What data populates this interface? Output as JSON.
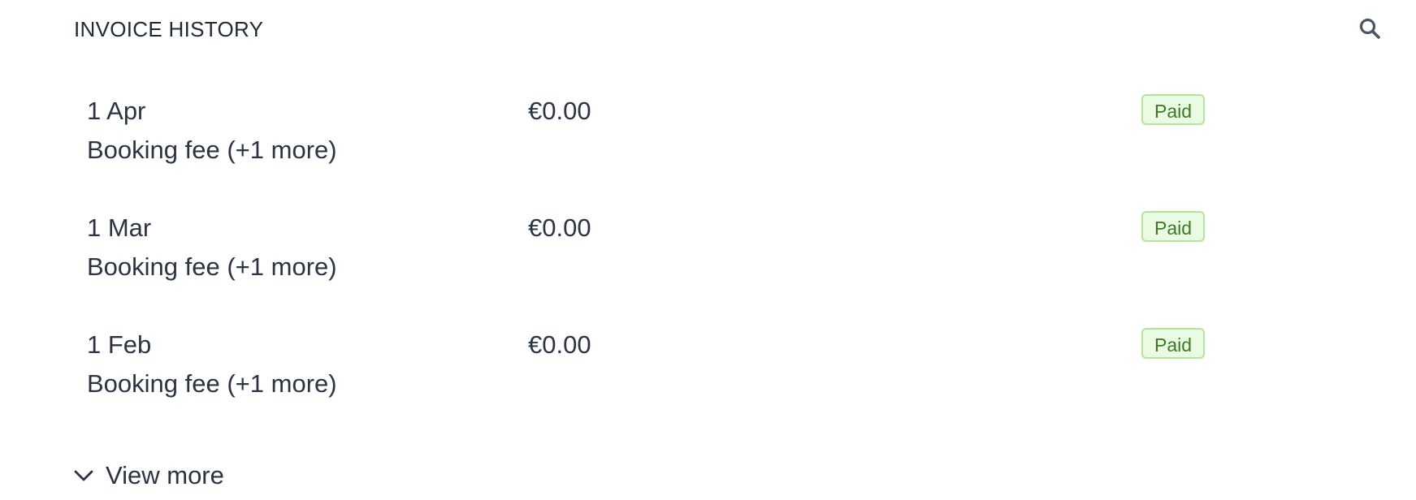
{
  "header": {
    "title": "INVOICE HISTORY",
    "search_icon": "search-icon"
  },
  "invoices": [
    {
      "date": "1 Apr",
      "description": "Booking fee (+1 more)",
      "amount": "€0.00",
      "status": "Paid"
    },
    {
      "date": "1 Mar",
      "description": "Booking fee (+1 more)",
      "amount": "€0.00",
      "status": "Paid"
    },
    {
      "date": "1 Feb",
      "description": "Booking fee (+1 more)",
      "amount": "€0.00",
      "status": "Paid"
    }
  ],
  "footer": {
    "view_more_label": "View more",
    "chevron_icon": "chevron-down-icon"
  },
  "colors": {
    "text": "#2a3443",
    "badge_bg": "#ebfbe3",
    "badge_border": "#b3e39c",
    "badge_text": "#3a7a25"
  }
}
